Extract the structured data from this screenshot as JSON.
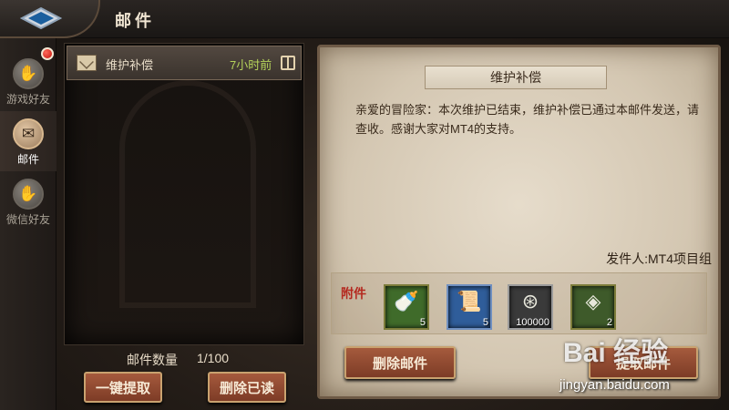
{
  "header": {
    "title": "邮件"
  },
  "sidebar": {
    "tabs": [
      {
        "label": "游戏好友",
        "icon": "handshake-icon"
      },
      {
        "label": "邮件",
        "icon": "mail-icon"
      },
      {
        "label": "微信好友",
        "icon": "handshake-icon"
      }
    ]
  },
  "mail_list": {
    "items": [
      {
        "subject": "维护补偿",
        "time": "7小时前"
      }
    ],
    "count_label": "邮件数量",
    "count_value": "1/100",
    "claim_all_label": "一键提取",
    "delete_read_label": "删除已读"
  },
  "mail_detail": {
    "subject": "维护补偿",
    "body": "亲爱的冒险家：本次维护已结束，维护补偿已通过本邮件发送，请查收。感谢大家对MT4的支持。",
    "sender": "发件人:MT4项目组",
    "attachments_label": "附件",
    "attachments": [
      {
        "icon": "milk-bottle-icon",
        "quantity": "5",
        "color": "#3f6b2a"
      },
      {
        "icon": "scroll-icon",
        "quantity": "5",
        "color": "#2f5d9a"
      },
      {
        "icon": "silver-coin-icon",
        "quantity": "100000",
        "color": "#3a3a3a"
      },
      {
        "icon": "green-gem-icon",
        "quantity": "2",
        "color": "#3e5a2a"
      }
    ],
    "delete_label": "删除邮件",
    "claim_label": "提取邮件"
  },
  "watermark": {
    "text": "Bai 经验",
    "url": "jingyan.baidu.com"
  }
}
